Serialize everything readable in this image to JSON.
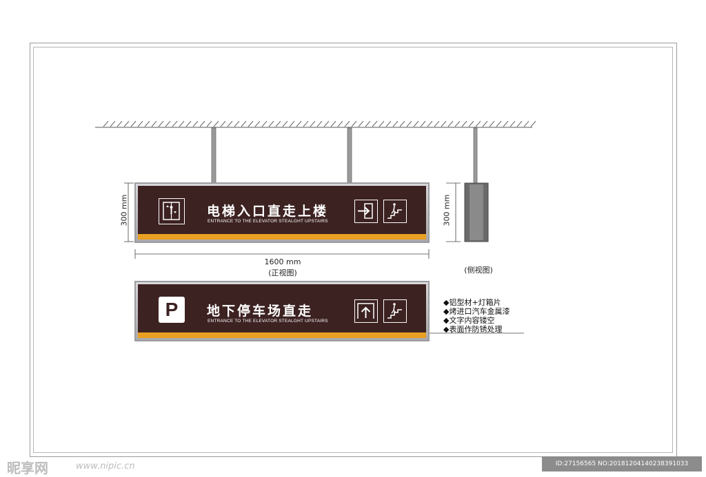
{
  "sign_front": {
    "title": "电梯入口直走上楼",
    "subtitle": "ENTRANCE TO THE ELEVATOR STEALGHT UPSTAIRS",
    "icons": [
      "elevator-icon",
      "entrance-arrow-icon",
      "stairs-up-icon"
    ]
  },
  "sign_bottom": {
    "title": "地下停车场直走",
    "subtitle": "ENTRANCE TO THE ELEVATOR STEALGHT UPSTAIRS",
    "parking_letter": "P",
    "icons": [
      "parking-icon",
      "up-arrow-door-icon",
      "stairs-up-icon"
    ]
  },
  "dimensions": {
    "height_left": "300 mm",
    "height_side": "300 mm",
    "width": "1600 mm",
    "front_view_label": "(正视图)",
    "side_view_label": "(侧视图)"
  },
  "notes": [
    "◆铝型材+灯箱片",
    "◆烤进口汽车金属漆",
    "◆文字内容镂空",
    "◆表面作防锈处理"
  ],
  "watermark": {
    "left_logo": "昵享网",
    "left_url": "www.nipic.cn",
    "right_id": "ID:27156565 NO:20181204140238391033"
  },
  "colors": {
    "sign_background": "#3d2222",
    "stripe": "#e99f22",
    "frame": "#9c9ca0"
  }
}
